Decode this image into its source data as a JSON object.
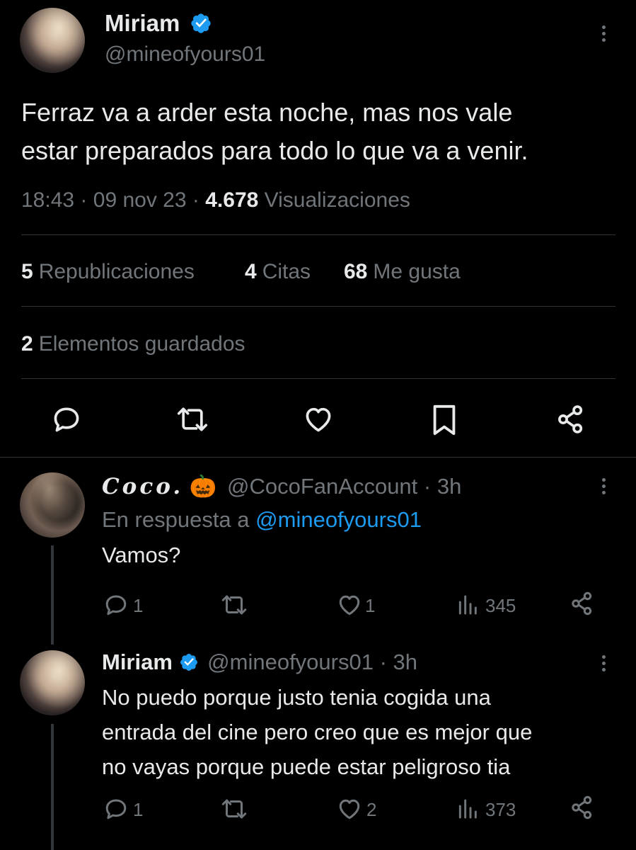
{
  "main_tweet": {
    "author_name": "Miriam",
    "author_handle": "@mineofyours01",
    "text_line1": "Ferraz va a arder esta noche, mas nos vale",
    "text_line2": "estar preparados para todo lo que va a venir.",
    "time": "18:43",
    "date": "09 nov 23",
    "views_count": "4.678",
    "views_label": "Visualizaciones",
    "separator": "·",
    "reposts_count": "5",
    "reposts_label": "Republicaciones",
    "quotes_count": "4",
    "quotes_label": "Citas",
    "likes_count": "68",
    "likes_label": "Me gusta",
    "bookmarks_count": "2",
    "bookmarks_label": "Elementos guardados"
  },
  "reply1": {
    "author_name": "Coco.",
    "author_emoji": "🎃",
    "author_handle": "@CocoFanAccount",
    "time": "· 3h",
    "reply_prefix": "En respuesta a",
    "reply_to": "@mineofyours01",
    "text": "Vamos?",
    "replies": "1",
    "likes": "1",
    "views": "345"
  },
  "reply2": {
    "author_name": "Miriam",
    "author_handle": "@mineofyours01",
    "time": "· 3h",
    "text_line1": "No puedo porque justo tenia cogida una",
    "text_line2": "entrada del cine pero creo que es mejor que",
    "text_line3": "no vayas porque puede estar peligroso tia",
    "replies": "1",
    "likes": "2",
    "views": "373"
  },
  "colors": {
    "background": "#000000",
    "text": "#e7e9ea",
    "muted": "#71767b",
    "accent": "#1d9bf0",
    "divider": "#2f3336"
  },
  "icons": [
    "more-icon",
    "verified-icon",
    "reply-icon",
    "repost-icon",
    "like-icon",
    "bookmark-icon",
    "share-icon",
    "views-icon"
  ]
}
